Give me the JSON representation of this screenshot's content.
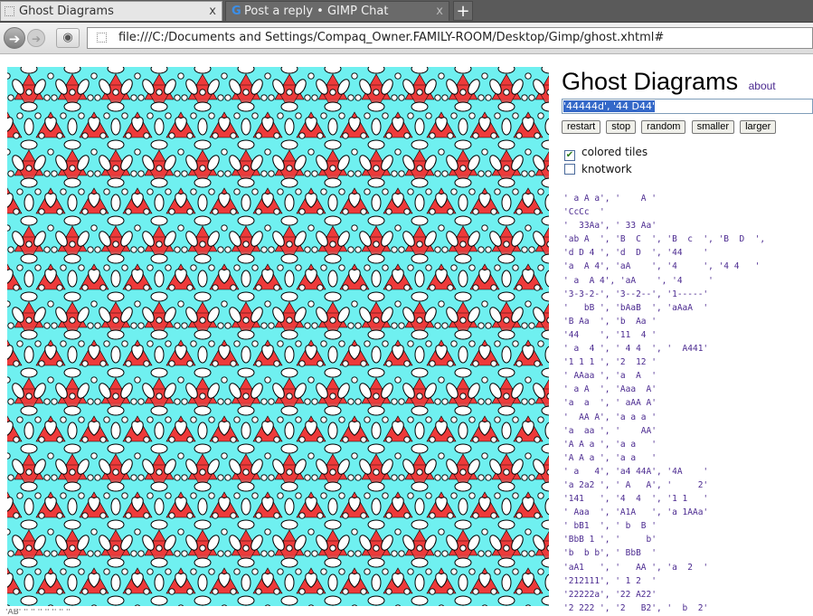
{
  "tabs": [
    {
      "label": "Ghost Diagrams",
      "close": "x",
      "active": true,
      "icon": "page-icon"
    },
    {
      "label": "Post a reply • GIMP Chat",
      "close": "x",
      "active": false,
      "icon": "gimpchat-g-icon"
    }
  ],
  "new_tab_label": "+",
  "nav": {
    "back_icon": "back-arrow-icon",
    "forward_icon": "forward-arrow-icon",
    "identity_icon": "eye-identity-icon",
    "url": "file:///C:/Documents and Settings/Compaq_Owner.FAMILY-ROOM/Desktop/Gimp/ghost.xhtml#"
  },
  "panel": {
    "title": "Ghost Diagrams",
    "about": "about",
    "spec_value": "'44444d', '44 D44'",
    "buttons": {
      "restart": "restart",
      "stop": "stop",
      "random": "random",
      "smaller": "smaller",
      "larger": "larger"
    },
    "options": {
      "colored_tiles": {
        "label": "colored tiles",
        "checked": true
      },
      "knotwork": {
        "label": "knotwork",
        "checked": false
      }
    },
    "examples": [
      "' a A a', '    A '",
      "'CcCc  '",
      "'  33Aa', ' 33 Aa'",
      "'ab A  ', 'B  C  ', 'B  c  ', 'B  D  ',",
      "'d D 4 ', 'd  D  ', '44    '",
      "'a  A 4', 'aA    ', '4     ', '4 4   '",
      "' a  A 4', 'aA    ', '4     '",
      "'3-3-2-', '3--2--', '1-----'",
      "'   bB ', 'bAaB  ', 'aAaA  '",
      "'B Aa  ', 'b  Aa '",
      "'44    ', '11  4 '",
      "' a  4 ', ' 4 4  ', '  A441'",
      "'1 1 1 ', '2  12 '",
      "' AAaa ', 'a  A  '",
      "' a A  ', 'Aaa  A'",
      "'a  a  ', ' aAA A'",
      "'  AA A', 'a a a '",
      "'a  aa ', '    AA'",
      "'A A a ', 'a a   '",
      "'A A a ', 'a a   '",
      "' a   4', 'a4 44A', '4A    '",
      "'a 2a2 ', ' A   A', '     2'",
      "'141   ', '4  4  ', '1 1   '",
      "' Aaa  ', 'A1A   ', 'a 1AAa'",
      "' bB1  ', ' b  B '",
      "'BbB 1 ', '     b'",
      "'b  b b', ' BbB  '",
      "'aA1   ', '   AA ', 'a  2  '",
      "'212111', ' 1 2  '",
      "'22222a', '22 A22'",
      "'2 222 ', '2   B2', '  b  2'"
    ]
  },
  "status_text": "'AB' '' '' '' '' '' '' ''",
  "colors": {
    "tile_cyan": "#6ff0f0",
    "tile_red": "#ee3a3a",
    "ellipse_white": "#ffffff",
    "outline": "#000000",
    "link": "#4b2a90"
  }
}
